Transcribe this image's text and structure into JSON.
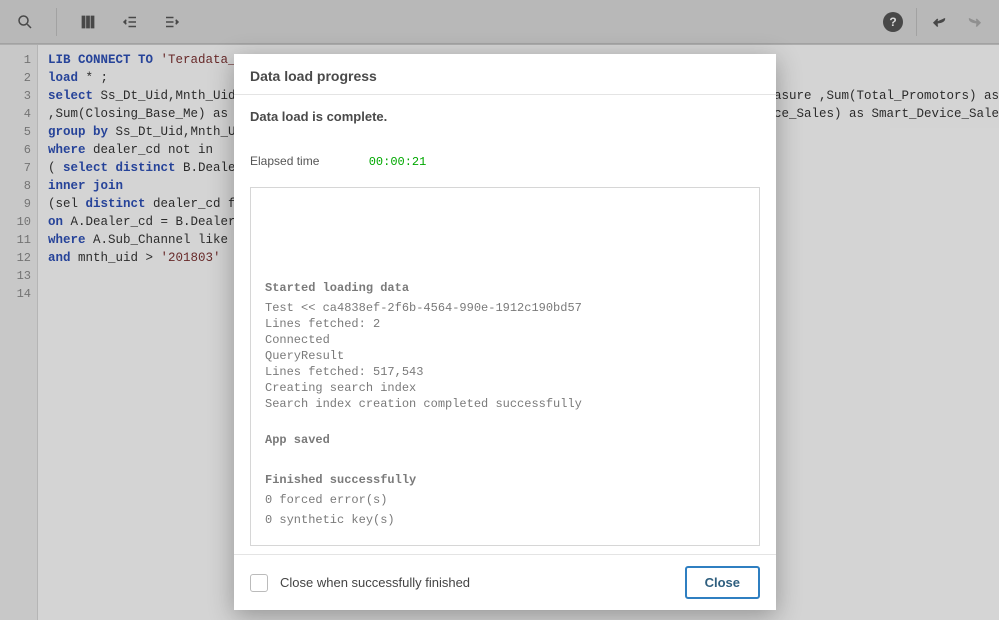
{
  "code": {
    "lines": [
      {
        "n": "1",
        "segments": [
          {
            "t": "LIB CONNECT TO ",
            "c": "kw"
          },
          {
            "t": "'Teradata_",
            "c": "str"
          }
        ]
      },
      {
        "n": "2",
        "segments": [
          {
            "t": "",
            "c": ""
          }
        ]
      },
      {
        "n": "3",
        "segments": [
          {
            "t": "load",
            "c": "kw"
          },
          {
            "t": " * ;",
            "c": ""
          }
        ]
      },
      {
        "n": "4",
        "segments": [
          {
            "t": "select",
            "c": "kw"
          },
          {
            "t": " Ss_Dt_Uid,Mnth_Uid",
            "c": ""
          }
        ],
        "tail": "easure ,Sum(Total_Promotors) as"
      },
      {
        "n": "5",
        "segments": [
          {
            "t": ",Sum(Closing_Base_Me) as ",
            "c": ""
          }
        ],
        "tail": "ice_Sales) as Smart_Device_Sale"
      },
      {
        "n": "6",
        "segments": [
          {
            "t": "group by",
            "c": "kw"
          },
          {
            "t": " Ss_Dt_Uid,Mnth_U",
            "c": ""
          }
        ]
      },
      {
        "n": "7",
        "segments": [
          {
            "t": "where",
            "c": "kw"
          },
          {
            "t": " dealer_cd not in",
            "c": ""
          }
        ]
      },
      {
        "n": "8",
        "segments": [
          {
            "t": "( ",
            "c": ""
          },
          {
            "t": "select distinct",
            "c": "kw"
          },
          {
            "t": " B.Deale",
            "c": ""
          }
        ]
      },
      {
        "n": "9",
        "segments": [
          {
            "t": "inner join",
            "c": "kw"
          }
        ]
      },
      {
        "n": "10",
        "segments": [
          {
            "t": "(sel ",
            "c": ""
          },
          {
            "t": "distinct",
            "c": "kw"
          },
          {
            "t": " dealer_cd f",
            "c": ""
          }
        ]
      },
      {
        "n": "11",
        "segments": [
          {
            "t": "on",
            "c": "kw"
          },
          {
            "t": " A.Dealer_cd = B.Dealer",
            "c": ""
          }
        ]
      },
      {
        "n": "12",
        "segments": [
          {
            "t": "where",
            "c": "kw"
          },
          {
            "t": " A.Sub_Channel like ",
            "c": ""
          }
        ]
      },
      {
        "n": "13",
        "segments": [
          {
            "t": "and",
            "c": "kw"
          },
          {
            "t": " mnth_uid > ",
            "c": ""
          },
          {
            "t": "'201803'",
            "c": "str"
          }
        ]
      },
      {
        "n": "14",
        "segments": [
          {
            "t": "",
            "c": ""
          }
        ]
      }
    ]
  },
  "modal": {
    "title": "Data load progress",
    "status": "Data load is complete.",
    "elapsed_label": "Elapsed time",
    "elapsed_time": "00:00:21",
    "log": {
      "heading1": "Started loading data",
      "lines1": [
        "Test << ca4838ef-2f6b-4564-990e-1912c190bd57",
        "Lines fetched: 2",
        "Connected",
        "QueryResult",
        "Lines fetched: 517,543",
        "Creating search index",
        "Search index creation completed successfully"
      ],
      "heading2": "App saved",
      "heading3": "Finished successfully",
      "lines3": [
        "0 forced error(s)",
        "0 synthetic key(s)"
      ]
    },
    "footer": {
      "checkbox_label": "Close when successfully finished",
      "close_label": "Close"
    }
  }
}
